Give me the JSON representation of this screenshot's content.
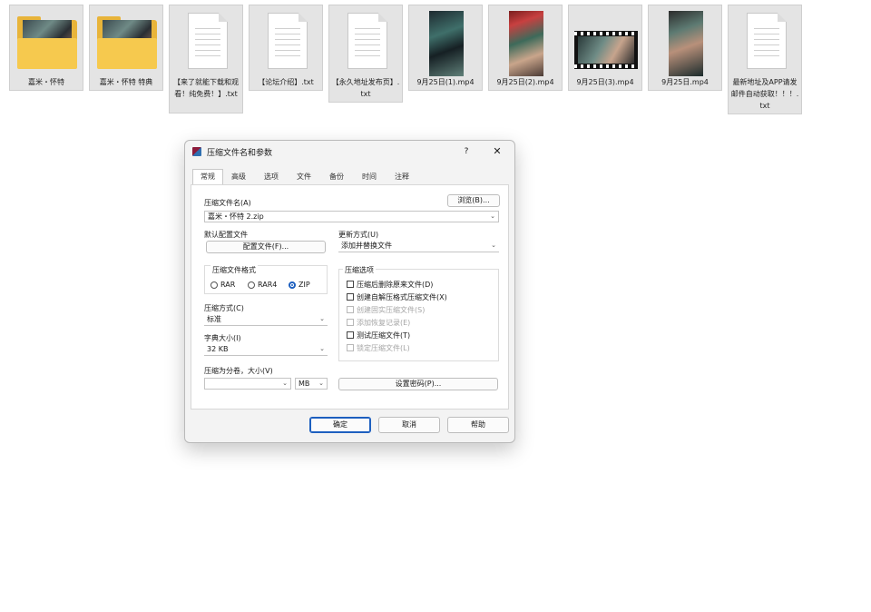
{
  "files": [
    {
      "kind": "folder",
      "name": "嘉米・怀特"
    },
    {
      "kind": "folder",
      "name": "嘉米・怀特 特典"
    },
    {
      "kind": "doc",
      "name": "【来了就能下载和观看！纯免费！】.txt"
    },
    {
      "kind": "doc",
      "name": "【论坛介绍】.txt"
    },
    {
      "kind": "doc",
      "name": "【永久地址发布页】.txt"
    },
    {
      "kind": "photo",
      "name": "9月25日(1).mp4"
    },
    {
      "kind": "photo",
      "name": "9月25日(2).mp4"
    },
    {
      "kind": "video",
      "name": "9月25日(3).mp4"
    },
    {
      "kind": "photo",
      "name": "9月25日.mp4"
    },
    {
      "kind": "doc",
      "name": "最新地址及APP请发邮件自动获取！！！.txt"
    }
  ],
  "dialog": {
    "title": "压缩文件名和参数",
    "help": "?",
    "close": "✕",
    "tabs": [
      "常规",
      "高级",
      "选项",
      "文件",
      "备份",
      "时间",
      "注释"
    ],
    "archive_name_label": "压缩文件名(A)",
    "browse_button": "浏览(B)...",
    "archive_name_value": "嘉米・怀特 2.zip",
    "default_profile_label": "默认配置文件",
    "profiles_button": "配置文件(F)...",
    "update_mode_label": "更新方式(U)",
    "update_mode_value": "添加并替换文件",
    "format_group_label": "压缩文件格式",
    "formats": [
      "RAR",
      "RAR4",
      "ZIP"
    ],
    "selected_format": "ZIP",
    "method_label": "压缩方式(C)",
    "method_value": "标准",
    "dict_label": "字典大小(I)",
    "dict_value": "32 KB",
    "split_label": "压缩为分卷，大小(V)",
    "split_value": "",
    "split_unit": "MB",
    "options_group_label": "压缩选项",
    "options": [
      {
        "label": "压缩后删除原来文件(D)",
        "enabled": true
      },
      {
        "label": "创建自解压格式压缩文件(X)",
        "enabled": true
      },
      {
        "label": "创建固实压缩文件(S)",
        "enabled": false
      },
      {
        "label": "添加恢复记录(E)",
        "enabled": false
      },
      {
        "label": "测试压缩文件(T)",
        "enabled": true
      },
      {
        "label": "锁定压缩文件(L)",
        "enabled": false
      }
    ],
    "password_button": "设置密码(P)...",
    "ok_button": "确定",
    "cancel_button": "取消",
    "help_button": "帮助"
  },
  "colors": {
    "folder": "#f6c94e",
    "accent": "#1d5fbf",
    "tile": "#e4e4e4"
  }
}
